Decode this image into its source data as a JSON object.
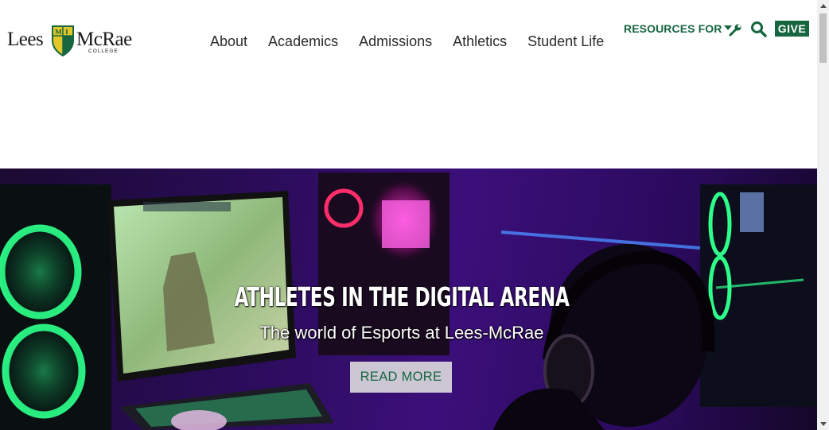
{
  "brand": {
    "name_part1": "Lees",
    "name_part2": "McRae",
    "sub": "COLLEGE",
    "shield_icon": "shield-logo-icon",
    "colors": {
      "green": "#16663f",
      "gold": "#e3c62a"
    }
  },
  "nav": {
    "items": [
      {
        "label": "About"
      },
      {
        "label": "Academics"
      },
      {
        "label": "Admissions"
      },
      {
        "label": "Athletics"
      },
      {
        "label": "Student Life"
      }
    ]
  },
  "utility": {
    "resources_label": "RESOURCES FOR",
    "resources_icon": "caret-down-icon",
    "tools_icon": "wrench-icon",
    "search_icon": "search-icon",
    "give_label": "GIVE"
  },
  "hero": {
    "title": "ATHLETES IN THE DIGITAL ARENA",
    "subtitle": "The world of Esports at Lees-McRae",
    "button_label": "READ MORE",
    "image_subject": "gaming-setup-photo"
  }
}
